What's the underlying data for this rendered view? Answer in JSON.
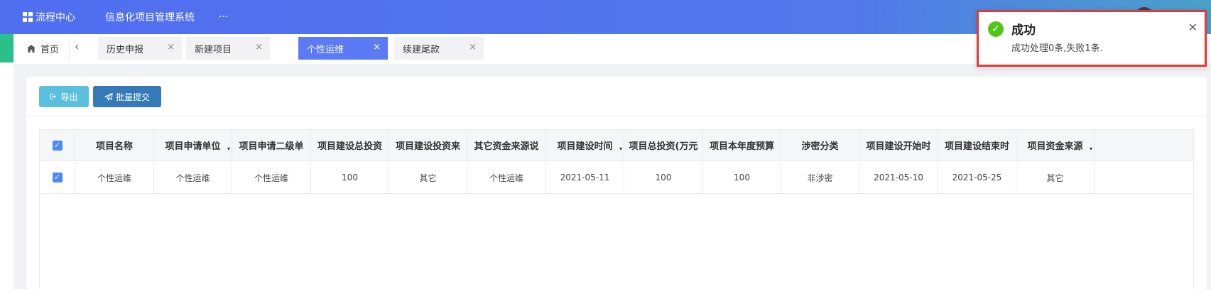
{
  "topbar": {
    "menu": [
      {
        "label": "流程中心",
        "icon": "grid-icon"
      },
      {
        "label": "信息化项目管理系统"
      },
      {
        "label": "···"
      }
    ]
  },
  "tabs": {
    "home_label": "首页",
    "items": [
      {
        "label": "历史申报",
        "active": false
      },
      {
        "label": "新建项目",
        "active": false
      },
      {
        "label": "个性运维",
        "active": true
      },
      {
        "label": "续建尾款",
        "active": false
      }
    ],
    "close_glyph": "×",
    "back_glyph": "‹"
  },
  "toolbar": {
    "export_label": "导出",
    "batch_submit_label": "批量提交"
  },
  "table": {
    "columns": [
      "项目名称",
      "项目申请单位",
      "项目申请二级单",
      "项目建设总投资",
      "项目建设投资来",
      "其它资金来源说",
      "项目建设时间",
      "项目总投资(万元",
      "项目本年度预算",
      "涉密分类",
      "项目建设开始时",
      "项目建设结束时",
      "项目资金来源"
    ],
    "rows": [
      {
        "checked": true,
        "cells": [
          "个性运维",
          "个性运维",
          "个性运维",
          "100",
          "其它",
          "个性运维",
          "2021-05-11",
          "100",
          "100",
          "非涉密",
          "2021-05-10",
          "2021-05-25",
          "其它"
        ]
      }
    ],
    "header_checked": true
  },
  "toast": {
    "title": "成功",
    "message": "成功处理0条,失败1条.",
    "status_color": "#52c41a",
    "highlight_color": "#e53935"
  },
  "colors": {
    "topbar": "#4f6ef0",
    "active_tab": "#5b7bf6",
    "export_button": "#5bc0de",
    "submit_button": "#337ab7"
  }
}
